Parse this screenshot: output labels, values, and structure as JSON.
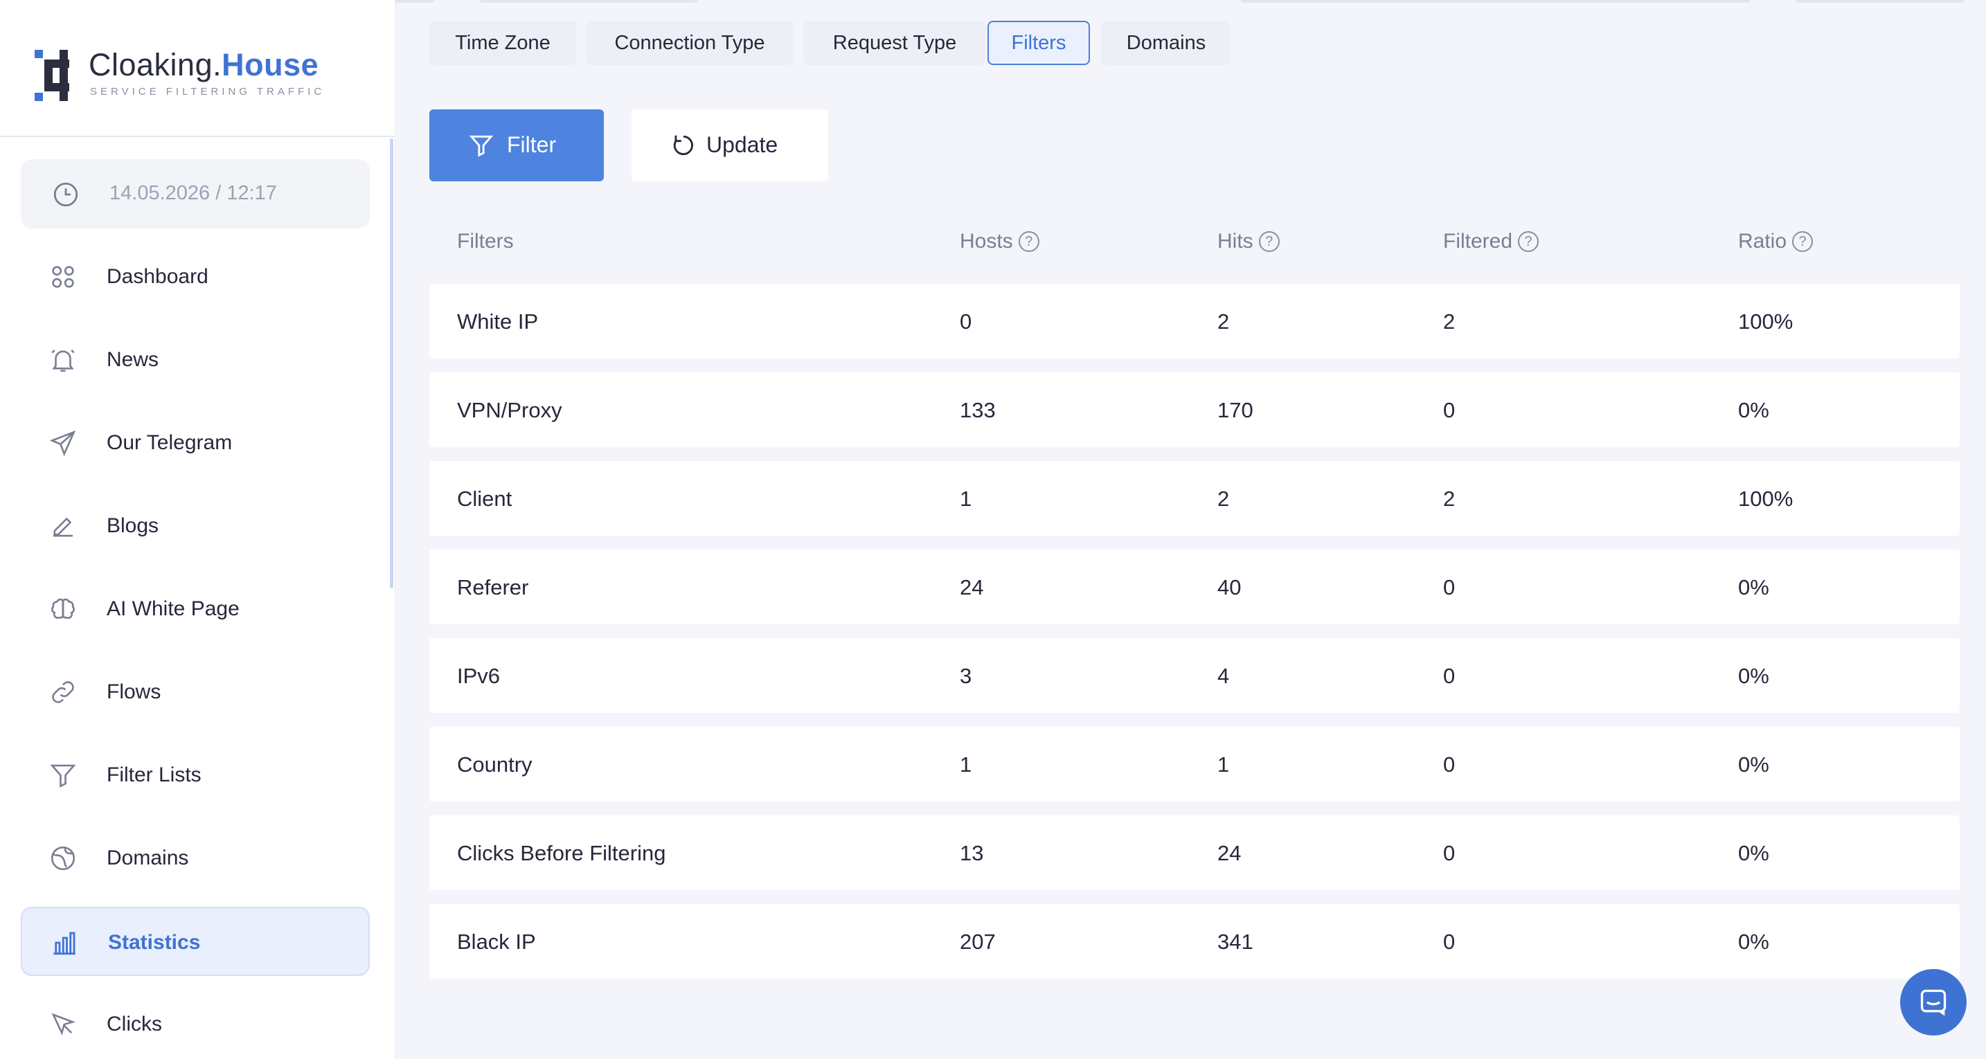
{
  "brand": {
    "name_part1": "Cloaking.",
    "name_part2": "House",
    "tagline": "SERVICE FILTERING TRAFFIC"
  },
  "sidebar": {
    "datetime": "14.05.2026 / 12:17",
    "items": [
      {
        "label": "Dashboard",
        "icon": "dashboard-icon"
      },
      {
        "label": "News",
        "icon": "bell-icon"
      },
      {
        "label": "Our Telegram",
        "icon": "send-icon"
      },
      {
        "label": "Blogs",
        "icon": "pencil-icon"
      },
      {
        "label": "AI White Page",
        "icon": "brain-icon"
      },
      {
        "label": "Flows",
        "icon": "link-icon"
      },
      {
        "label": "Filter Lists",
        "icon": "filter-icon"
      },
      {
        "label": "Domains",
        "icon": "globe-icon"
      },
      {
        "label": "Statistics",
        "icon": "bar-chart-icon",
        "active": true
      },
      {
        "label": "Clicks",
        "icon": "cursor-icon"
      }
    ]
  },
  "tabs": [
    {
      "label": "Time Zone"
    },
    {
      "label": "Connection Type"
    },
    {
      "label": "Request Type"
    },
    {
      "label": "Filters",
      "active": true
    },
    {
      "label": "Domains"
    }
  ],
  "actions": {
    "filter_label": "Filter",
    "update_label": "Update"
  },
  "table": {
    "headers": [
      "Filters",
      "Hosts",
      "Hits",
      "Filtered",
      "Ratio"
    ],
    "rows": [
      [
        "White IP",
        "0",
        "2",
        "2",
        "100%"
      ],
      [
        "VPN/Proxy",
        "133",
        "170",
        "0",
        "0%"
      ],
      [
        "Client",
        "1",
        "2",
        "2",
        "100%"
      ],
      [
        "Referer",
        "24",
        "40",
        "0",
        "0%"
      ],
      [
        "IPv6",
        "3",
        "4",
        "0",
        "0%"
      ],
      [
        "Country",
        "1",
        "1",
        "0",
        "0%"
      ],
      [
        "Clicks Before Filtering",
        "13",
        "24",
        "0",
        "0%"
      ],
      [
        "Black IP",
        "207",
        "341",
        "0",
        "0%"
      ]
    ]
  },
  "help_glyph": "?",
  "colors": {
    "accent": "#3f73d3",
    "accent_button": "#4f83e0",
    "background": "#f4f5fb"
  }
}
